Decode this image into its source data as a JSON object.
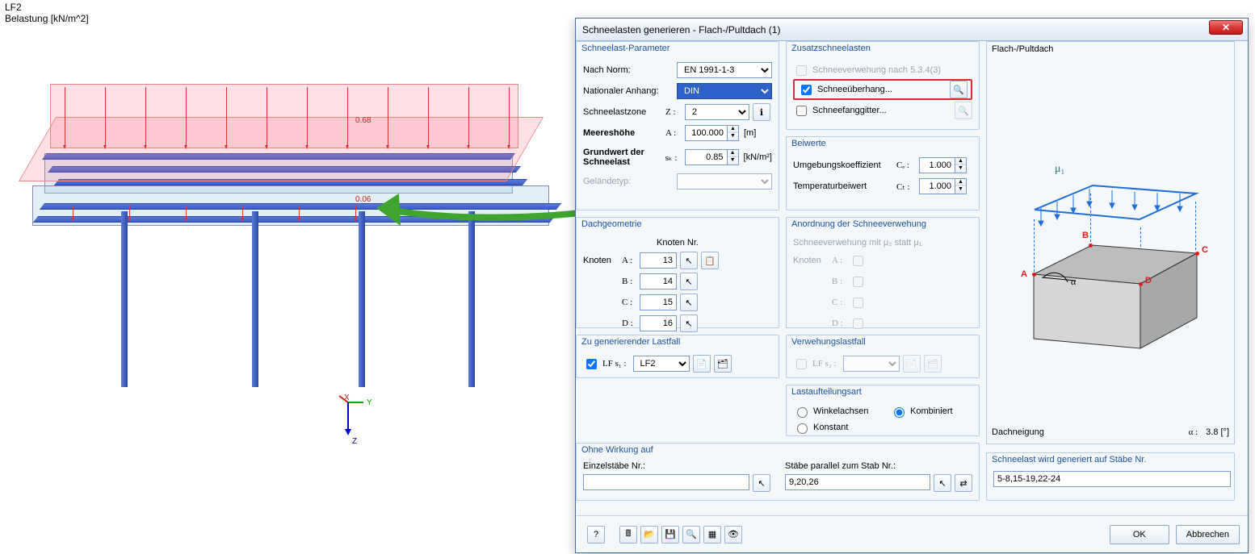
{
  "viewport": {
    "label_line1": "LF2",
    "label_line2": "Belastung [kN/m^2]",
    "load_values": {
      "top": "0.68",
      "edge": "0.06"
    },
    "axis": {
      "x": "X",
      "y": "Y",
      "z": "Z"
    }
  },
  "dialog": {
    "title": "Schneelasten generieren  -  Flach-/Pultdach   (1)",
    "close": "✕",
    "groups": {
      "params": {
        "title": "Schneelast-Parameter",
        "norm_label": "Nach Norm:",
        "norm_value": "EN 1991-1-3",
        "annex_label": "Nationaler Anhang:",
        "annex_value": "DIN",
        "zone_label": "Schneelastzone",
        "zone_sym": "Z :",
        "zone_value": "2",
        "altitude_label": "Meereshöhe",
        "altitude_sym": "A :",
        "altitude_value": "100.000",
        "altitude_unit": "[m]",
        "sk_label": "Grundwert der Schneelast",
        "sk_sym": "sₖ :",
        "sk_value": "0.85",
        "sk_unit": "[kN/m²]",
        "terrain_label": "Geländetyp:"
      },
      "extra": {
        "title": "Zusatzschneelasten",
        "drift_label": "Schneeverwehung nach 5.3.4(3)",
        "overhang_label": "Schneeüberhang...",
        "guard_label": "Schneefanggitter..."
      },
      "coeffs": {
        "title": "Beiwerte",
        "ce_label": "Umgebungskoeffizient",
        "ce_sym": "Cₑ :",
        "ce_value": "1.000",
        "ct_label": "Temperaturbeiwert",
        "ct_sym": "Cₜ :",
        "ct_value": "1.000"
      },
      "geom": {
        "title": "Dachgeometrie",
        "col_header": "Knoten Nr.",
        "node_label": "Knoten",
        "rows": [
          {
            "sym": "A :",
            "val": "13"
          },
          {
            "sym": "B :",
            "val": "14"
          },
          {
            "sym": "C :",
            "val": "15"
          },
          {
            "sym": "D :",
            "val": "16"
          }
        ]
      },
      "drift_geom": {
        "title": "Anordnung der Schneeverwehung",
        "hint": "Schneeverwehung mit μ₂ statt μ₁",
        "node_label": "Knoten",
        "rows": [
          {
            "sym": "A :"
          },
          {
            "sym": "B :"
          },
          {
            "sym": "C :"
          },
          {
            "sym": "D :"
          }
        ]
      },
      "lc": {
        "title": "Zu generierender Lastfall",
        "cb_label": "LF s₁ :",
        "value": "LF2"
      },
      "drift_lc": {
        "title": "Verwehungslastfall",
        "cb_label": "LF s₂ :"
      },
      "distrib": {
        "title": "Lastaufteilungsart",
        "opt1": "Winkelachsen",
        "opt2": "Kombiniert",
        "opt3": "Konstant"
      },
      "without": {
        "title": "Ohne Wirkung auf",
        "single_label": "Einzelstäbe Nr.:",
        "parallel_label": "Stäbe parallel zum Stab Nr.:",
        "parallel_value": "9,20,26"
      },
      "target": {
        "title": "Schneelast wird generiert auf Stäbe Nr.",
        "value": "5-8,15-19,22-24"
      }
    },
    "preview": {
      "title": "Flach-/Pultdach",
      "mu": "μ₁",
      "pts": {
        "a": "A",
        "b": "B",
        "c": "C",
        "d": "D"
      },
      "alpha_sym": "α",
      "slope_label": "Dachneigung",
      "slope_sym": "α :",
      "slope_value": "3.8 [°]"
    },
    "footer": {
      "ok": "OK",
      "cancel": "Abbrechen"
    }
  }
}
